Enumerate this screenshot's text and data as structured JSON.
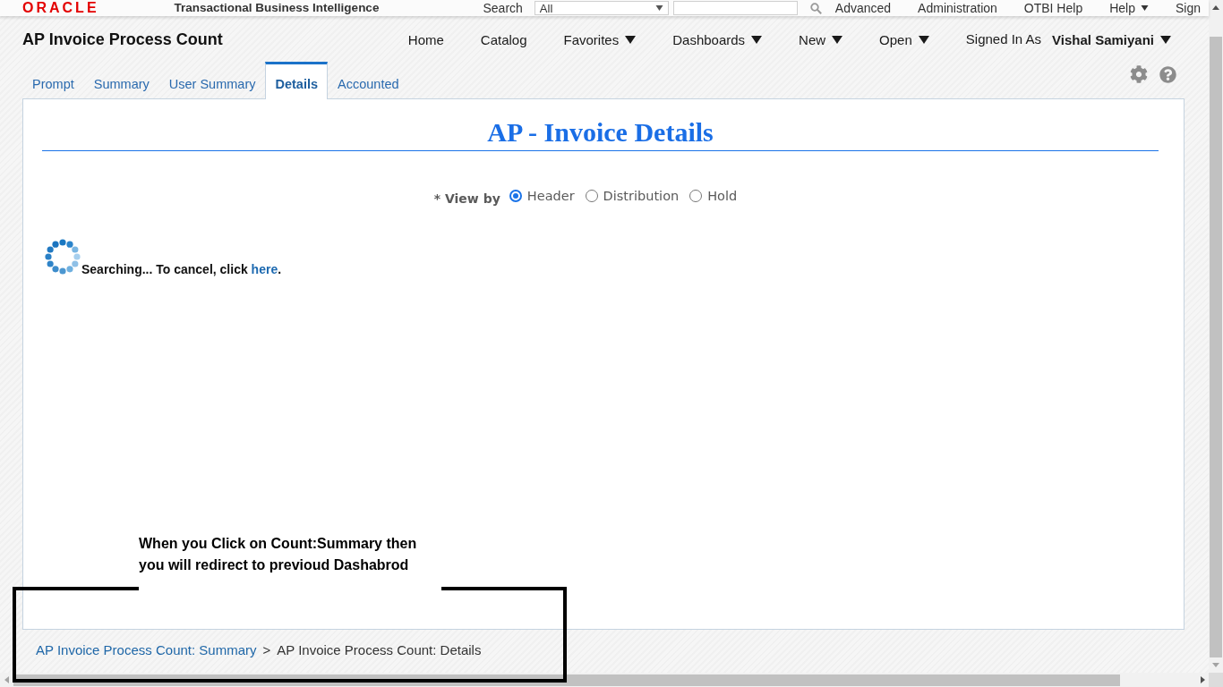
{
  "top_bar": {
    "logo": "ORACLE",
    "product": "Transactional Business Intelligence",
    "search": {
      "label": "Search",
      "scope": "All"
    },
    "links": [
      {
        "label": "Advanced",
        "has_menu": false
      },
      {
        "label": "Administration",
        "has_menu": false
      },
      {
        "label": "OTBI Help",
        "has_menu": false
      },
      {
        "label": "Help",
        "has_menu": true
      },
      {
        "label": "Sign",
        "has_menu": false
      }
    ]
  },
  "header": {
    "title": "AP Invoice Process Count",
    "nav": [
      {
        "label": "Home",
        "has_menu": false
      },
      {
        "label": "Catalog",
        "has_menu": false
      },
      {
        "label": "Favorites",
        "has_menu": true
      },
      {
        "label": "Dashboards",
        "has_menu": true
      },
      {
        "label": "New",
        "has_menu": true
      },
      {
        "label": "Open",
        "has_menu": true
      }
    ],
    "signed_in": {
      "label": "Signed In As",
      "user": "Vishal Samiyani",
      "has_menu": true
    }
  },
  "tabs": [
    {
      "label": "Prompt",
      "selected": false
    },
    {
      "label": "Summary",
      "selected": false
    },
    {
      "label": "User Summary",
      "selected": false
    },
    {
      "label": "Details",
      "selected": true
    },
    {
      "label": "Accounted",
      "selected": false
    }
  ],
  "report": {
    "title": "AP - Invoice Details",
    "view_by": {
      "label": "* View by",
      "options": [
        {
          "label": "Header",
          "selected": true
        },
        {
          "label": "Distribution",
          "selected": false
        },
        {
          "label": "Hold",
          "selected": false
        }
      ]
    },
    "status": {
      "text": "Searching... To cancel, click",
      "link": "here",
      "end": "."
    }
  },
  "breadcrumb": {
    "separator": ">",
    "items": [
      {
        "label": "AP Invoice Process Count: Summary",
        "current": false
      },
      {
        "label": "AP Invoice Process Count: Details",
        "current": true
      }
    ]
  },
  "annotation": {
    "lines": [
      "When you Click on Count:Summary then",
      "you will redirect to previoud Dashabrod"
    ]
  }
}
